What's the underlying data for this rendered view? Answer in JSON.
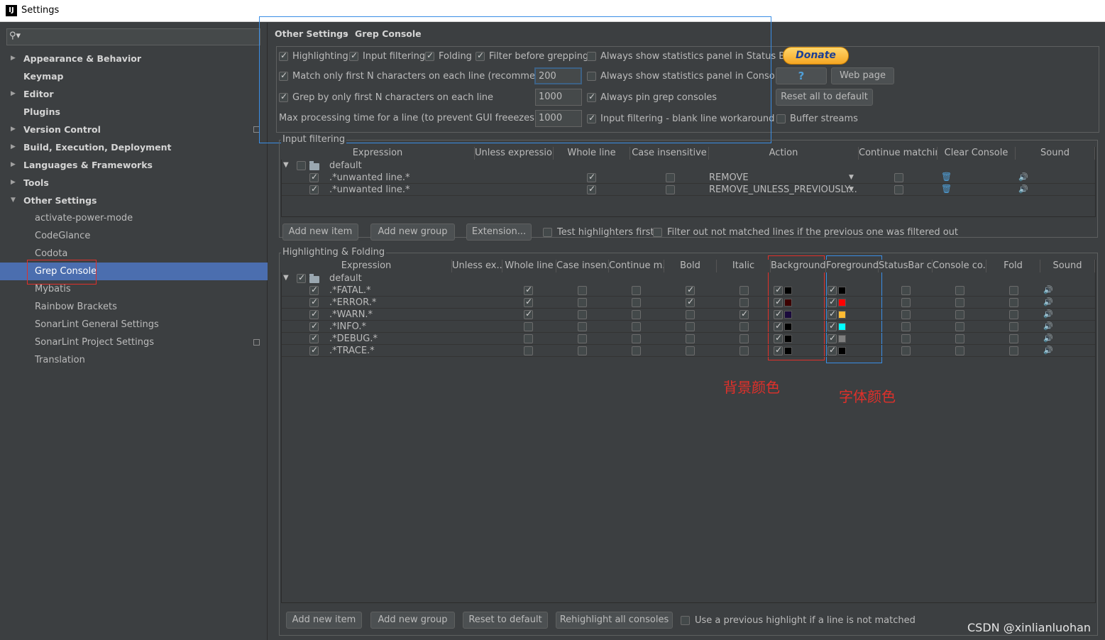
{
  "window": {
    "title": "Settings"
  },
  "sidebar": {
    "search_placeholder": "",
    "items": [
      {
        "label": "Appearance & Behavior"
      },
      {
        "label": "Keymap"
      },
      {
        "label": "Editor"
      },
      {
        "label": "Plugins"
      },
      {
        "label": "Version Control"
      },
      {
        "label": "Build, Execution, Deployment"
      },
      {
        "label": "Languages & Frameworks"
      },
      {
        "label": "Tools"
      },
      {
        "label": "Other Settings"
      },
      {
        "label": "activate-power-mode"
      },
      {
        "label": "CodeGlance"
      },
      {
        "label": "Codota"
      },
      {
        "label": "Grep Console"
      },
      {
        "label": "Mybatis"
      },
      {
        "label": "Rainbow Brackets"
      },
      {
        "label": "SonarLint General Settings"
      },
      {
        "label": "SonarLint Project Settings"
      },
      {
        "label": "Translation"
      }
    ]
  },
  "breadcrumb": {
    "parent": "Other Settings",
    "sep": "›",
    "current": "Grep Console"
  },
  "options": {
    "highlighting": "Highlighting",
    "input_filtering": "Input filtering",
    "folding": "Folding",
    "filter_before_grepping": "Filter before grepping",
    "always_show_stats_statusbar": "Always show statistics panel in Status Bar",
    "match_first_n": "Match only first N characters on each line (recommended)",
    "match_first_n_value": "200",
    "always_show_stats_console": "Always show statistics panel in Console",
    "grep_first_n": "Grep by only first N characters on each line",
    "grep_first_n_value": "1000",
    "always_pin": "Always pin grep consoles",
    "max_processing": "Max processing time for a line (to prevent GUI freeezes) [ms]",
    "max_processing_value": "1000",
    "blank_line_workaround": "Input filtering - blank line workaround",
    "buffer_streams": "Buffer streams"
  },
  "buttons": {
    "donate": "Donate",
    "help": "?",
    "web_page": "Web page",
    "reset_all": "Reset all to default"
  },
  "input_filtering": {
    "legend": "Input filtering",
    "columns": [
      "Expression",
      "Unless expression",
      "Whole line",
      "Case insensitive",
      "Action",
      "Continue matching",
      "Clear Console",
      "Sound"
    ],
    "group": "default",
    "rows": [
      {
        "expression": ".*unwanted line.*",
        "action": "REMOVE"
      },
      {
        "expression": ".*unwanted line.*",
        "action": "REMOVE_UNLESS_PREVIOUSLY..."
      }
    ],
    "add_item": "Add new item",
    "add_group": "Add new group",
    "extension": "Extension...",
    "test_highlighters_first": "Test highlighters first",
    "filter_out_not_matched": "Filter out not matched lines if the previous one was filtered out"
  },
  "highlighting": {
    "legend": "Highlighting & Folding",
    "columns": [
      "Expression",
      "Unless ex...",
      "Whole line",
      "Case insen...",
      "Continue m...",
      "Bold",
      "Italic",
      "Background",
      "Foreground",
      "StatusBar c...",
      "Console co...",
      "Fold",
      "Sound"
    ],
    "group": "default",
    "rows": [
      {
        "expression": ".*FATAL.*",
        "whole": true,
        "bold": true,
        "italic": false,
        "bg": "#000000",
        "fg": "#000000"
      },
      {
        "expression": ".*ERROR.*",
        "whole": true,
        "bold": true,
        "italic": false,
        "bg": "#3c0000",
        "fg": "#ff0000"
      },
      {
        "expression": ".*WARN.*",
        "whole": true,
        "bold": false,
        "italic": true,
        "bg": "#1a0a3c",
        "fg": "#ffbb33"
      },
      {
        "expression": ".*INFO.*",
        "whole": false,
        "bold": false,
        "italic": false,
        "bg": "#000000",
        "fg": "#00ffff"
      },
      {
        "expression": ".*DEBUG.*",
        "whole": false,
        "bold": false,
        "italic": false,
        "bg": "#000000",
        "fg": "#808080"
      },
      {
        "expression": ".*TRACE.*",
        "whole": false,
        "bold": false,
        "italic": false,
        "bg": "#000000",
        "fg": "#000000"
      }
    ],
    "add_item": "Add new item",
    "add_group": "Add new group",
    "reset_default": "Reset to default",
    "rehighlight": "Rehighlight all consoles",
    "use_previous": "Use a previous highlight if a line is not matched"
  },
  "annotations": {
    "background_label": "背景颜色",
    "foreground_label": "字体颜色",
    "watermark": "CSDN @xinlianluohan"
  }
}
